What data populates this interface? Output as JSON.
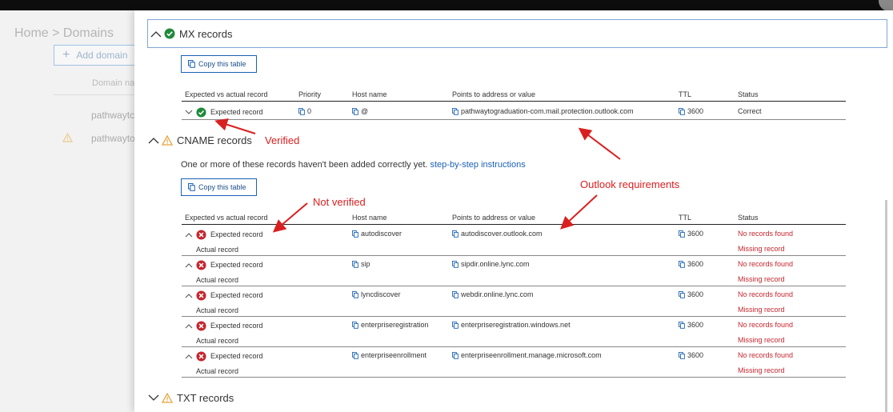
{
  "background": {
    "breadcrumb": "Home > Domains",
    "add_domain": "Add domain",
    "column_header": "Domain na",
    "rows": [
      "pathwaytc",
      "pathwayto"
    ]
  },
  "mx": {
    "title": "MX records",
    "copy_label": "Copy this table",
    "headers": {
      "record": "Expected vs actual record",
      "priority": "Priority",
      "host": "Host name",
      "points": "Points to address or value",
      "ttl": "TTL",
      "status": "Status"
    },
    "row": {
      "record": "Expected record",
      "priority": "0",
      "host": "@",
      "points": "pathwaytograduation-com.mail.protection.outlook.com",
      "ttl": "3600",
      "status": "Correct"
    }
  },
  "cname": {
    "title": "CNAME records",
    "description": "One or more of these records haven't been added correctly yet.",
    "link": "step-by-step instructions",
    "copy_label": "Copy this table",
    "headers": {
      "record": "Expected vs actual record",
      "host": "Host name",
      "points": "Points to address or value",
      "ttl": "TTL",
      "status": "Status"
    },
    "rows": [
      {
        "expected": "Expected record",
        "actual": "Actual record",
        "host": "autodiscover",
        "points": "autodiscover.outlook.com",
        "ttl": "3600",
        "status": "No records found",
        "actual_status": "Missing record"
      },
      {
        "expected": "Expected record",
        "actual": "Actual record",
        "host": "sip",
        "points": "sipdir.online.lync.com",
        "ttl": "3600",
        "status": "No records found",
        "actual_status": "Missing record"
      },
      {
        "expected": "Expected record",
        "actual": "Actual record",
        "host": "lyncdiscover",
        "points": "webdir.online.lync.com",
        "ttl": "3600",
        "status": "No records found",
        "actual_status": "Missing record"
      },
      {
        "expected": "Expected record",
        "actual": "Actual record",
        "host": "enterpriseregistration",
        "points": "enterpriseregistration.windows.net",
        "ttl": "3600",
        "status": "No records found",
        "actual_status": "Missing record"
      },
      {
        "expected": "Expected record",
        "actual": "Actual record",
        "host": "enterpriseenrollment",
        "points": "enterpriseenrollment.manage.microsoft.com",
        "ttl": "3600",
        "status": "No records found",
        "actual_status": "Missing record"
      }
    ]
  },
  "txt": {
    "title": "TXT records"
  },
  "annotations": {
    "verified": "Verified",
    "not_verified": "Not verified",
    "outlook": "Outlook requirements"
  },
  "colors": {
    "accent": "#1b62b3",
    "error": "#c4262e",
    "success": "#1f8a3b",
    "warning": "#e8a33a",
    "annotation": "#d92020"
  }
}
